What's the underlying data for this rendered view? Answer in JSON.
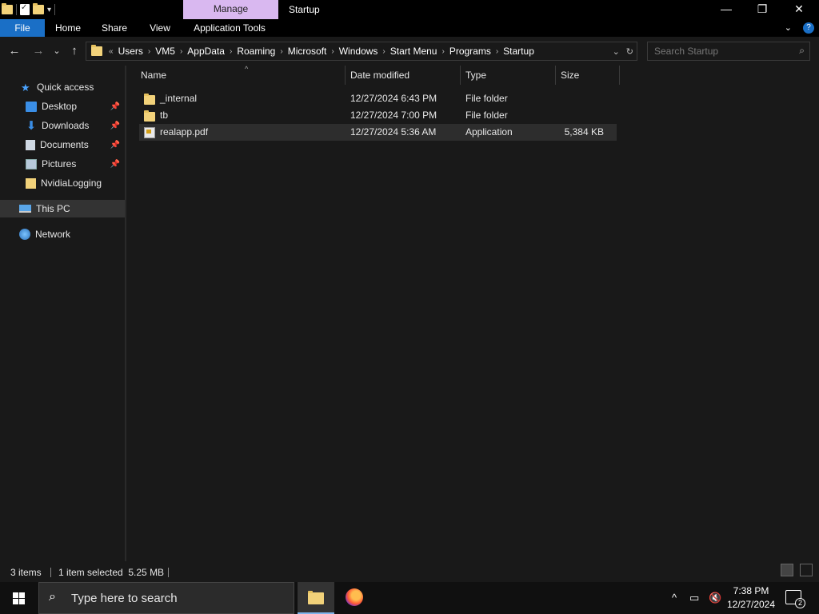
{
  "titlebar": {
    "context_tab": "Manage",
    "title": "Startup",
    "minimize": "—",
    "restore": "❐",
    "close": "✕"
  },
  "ribbon": {
    "tabs": [
      "File",
      "Home",
      "Share",
      "View",
      "Application Tools"
    ],
    "expand": "⌄",
    "help": "?"
  },
  "nav": {
    "back": "←",
    "forward": "→",
    "recent": "⌄",
    "up": "↑",
    "overflow": "«",
    "breadcrumbs": [
      "Users",
      "VM5",
      "AppData",
      "Roaming",
      "Microsoft",
      "Windows",
      "Start Menu",
      "Programs",
      "Startup"
    ],
    "history_dropdown": "⌄",
    "refresh": "↻"
  },
  "search": {
    "placeholder": "Search Startup",
    "icon": "search-icon"
  },
  "sidebar": {
    "items": [
      {
        "label": "Quick access",
        "icon": "star-icon",
        "pinned": false
      },
      {
        "label": "Desktop",
        "icon": "desktop-icon",
        "pinned": true
      },
      {
        "label": "Downloads",
        "icon": "download-icon",
        "pinned": true
      },
      {
        "label": "Documents",
        "icon": "documents-icon",
        "pinned": true
      },
      {
        "label": "Pictures",
        "icon": "pictures-icon",
        "pinned": true
      },
      {
        "label": "NvidiaLogging",
        "icon": "folder-icon",
        "pinned": false
      },
      {
        "label": "This PC",
        "icon": "computer-icon",
        "pinned": false
      },
      {
        "label": "Network",
        "icon": "network-icon",
        "pinned": false
      }
    ]
  },
  "table": {
    "columns": [
      "Name",
      "Date modified",
      "Type",
      "Size"
    ],
    "rows": [
      {
        "name": "_internal",
        "date": "12/27/2024 6:43 PM",
        "type": "File folder",
        "size": "",
        "icon": "folder-icon"
      },
      {
        "name": "tb",
        "date": "12/27/2024 7:00 PM",
        "type": "File folder",
        "size": "",
        "icon": "folder-icon"
      },
      {
        "name": "realapp.pdf",
        "date": "12/27/2024 5:36 AM",
        "type": "Application",
        "size": "5,384 KB",
        "icon": "application-icon",
        "selected": true
      }
    ]
  },
  "status": {
    "count": "3 items",
    "selection": "1 item selected  5.25 MB"
  },
  "taskbar": {
    "search_placeholder": "Type here to search",
    "time": "7:38 PM",
    "date": "12/27/2024",
    "notifications": "2"
  },
  "colors": {
    "accent": "#1a6fc6",
    "manage_tab": "#d9b8f0",
    "background": "#191919",
    "folder": "#f2d27a"
  }
}
